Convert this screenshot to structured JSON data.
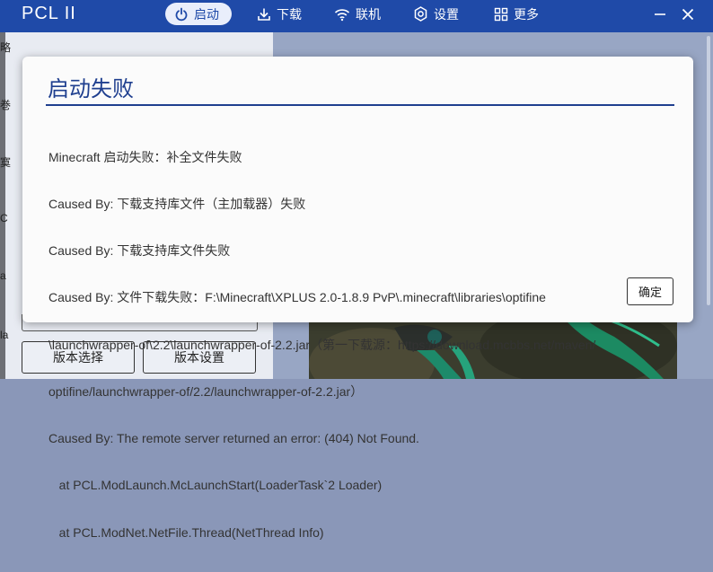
{
  "app": {
    "title": "PCL II"
  },
  "nav": {
    "launch": "启动",
    "download": "下载",
    "online": "联机",
    "settings": "设置",
    "more": "更多"
  },
  "left": {
    "fragments": [
      "略",
      "巻",
      "寞",
      "C",
      "a",
      "la"
    ],
    "version_select": "版本选择",
    "version_settings": "版本设置"
  },
  "dialog": {
    "title": "启动失败",
    "lines": [
      "Minecraft 启动失败：补全文件失败",
      "Caused By: 下载支持库文件（主加载器）失败",
      "Caused By: 下载支持库文件失败",
      "Caused By: 文件下载失败：F:\\Minecraft\\XPLUS 2.0-1.8.9 PvP\\.minecraft\\libraries\\optifine",
      "\\launchwrapper-of\\2.2\\launchwrapper-of-2.2.jar（第一下载源：https://download.mcbbs.net/maven/",
      "optifine/launchwrapper-of/2.2/launchwrapper-of-2.2.jar）",
      "Caused By: The remote server returned an error: (404) Not Found.",
      "   at PCL.ModLaunch.McLaunchStart(LoaderTask`2 Loader)",
      "   at PCL.ModNet.NetFile.Thread(NetThread Info)"
    ],
    "ok": "确定"
  },
  "colors": {
    "titlebar": "#1f4aa8",
    "accent": "#1f3f8f"
  },
  "icons": {
    "launch": "power-icon",
    "download": "download-icon",
    "online": "wifi-icon",
    "settings": "gear-icon",
    "more": "grid-icon",
    "minimize": "minimize-icon",
    "close": "close-icon"
  }
}
